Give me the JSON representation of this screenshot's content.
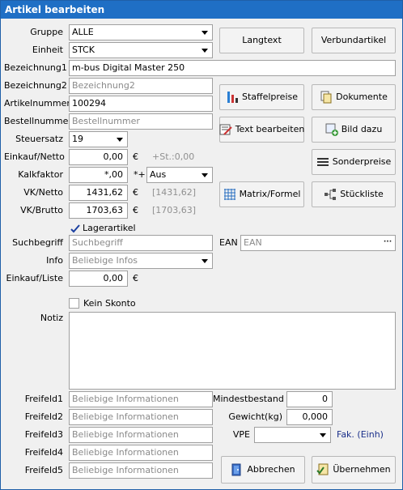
{
  "window": {
    "title": "Artikel bearbeiten"
  },
  "form": {
    "gruppe": {
      "label": "Gruppe",
      "value": "ALLE"
    },
    "einheit": {
      "label": "Einheit",
      "value": "STCK"
    },
    "bezeichnung1": {
      "label": "Bezeichnung1",
      "value": "m-bus Digital Master 250"
    },
    "bezeichnung2": {
      "label": "Bezeichnung2",
      "placeholder": "Bezeichnung2"
    },
    "artikelnummer": {
      "label": "Artikelnummer",
      "value": "100294"
    },
    "bestellnummer": {
      "label": "Bestellnummer",
      "placeholder": "Bestellnummer"
    },
    "steuersatz": {
      "label": "Steuersatz",
      "value": "19"
    },
    "einkauf_netto": {
      "label": "Einkauf/Netto",
      "value": "0,00",
      "currency": "€",
      "extra": "+St.:0,00"
    },
    "kalkfaktor": {
      "label": "Kalkfaktor",
      "value": "*,00",
      "operator": "*+",
      "mode": "Aus"
    },
    "vk_netto": {
      "label": "VK/Netto",
      "value": "1431,62",
      "currency": "€",
      "bracket": "[1431,62]"
    },
    "vk_brutto": {
      "label": "VK/Brutto",
      "value": "1703,63",
      "currency": "€",
      "bracket": "[1703,63]"
    },
    "lagerartikel": {
      "label": "Lagerartikel",
      "checked": true
    },
    "suchbegriff": {
      "label": "Suchbegriff",
      "placeholder": "Suchbegriff"
    },
    "ean": {
      "label": "EAN",
      "placeholder": "EAN",
      "button": "···"
    },
    "info": {
      "label": "Info",
      "placeholder": "Beliebige Infos"
    },
    "einkauf_liste": {
      "label": "Einkauf/Liste",
      "value": "0,00",
      "currency": "€"
    },
    "kein_skonto": {
      "label": "Kein Skonto",
      "checked": false
    },
    "notiz": {
      "label": "Notiz",
      "value": ""
    },
    "freifelder": [
      {
        "label": "Freifeld1",
        "placeholder": "Beliebige Informationen"
      },
      {
        "label": "Freifeld2",
        "placeholder": "Beliebige Informationen"
      },
      {
        "label": "Freifeld3",
        "placeholder": "Beliebige Informationen"
      },
      {
        "label": "Freifeld4",
        "placeholder": "Beliebige Informationen"
      },
      {
        "label": "Freifeld5",
        "placeholder": "Beliebige Informationen"
      }
    ],
    "mindestbestand": {
      "label": "Mindestbestand",
      "value": "0"
    },
    "gewicht": {
      "label": "Gewicht(kg)",
      "value": "0,000"
    },
    "vpe": {
      "label": "VPE",
      "value": "",
      "unit_text": "Fak. (Einh)"
    }
  },
  "buttons": {
    "langtext": "Langtext",
    "verbundartikel": "Verbundartikel",
    "staffelpreise": "Staffelpreise",
    "dokumente": "Dokumente",
    "text_bearbeiten": "Text bearbeiten",
    "bild_dazu": "Bild dazu",
    "sonderpreise": "Sonderpreise",
    "matrix_formel": "Matrix/Formel",
    "stueckliste": "Stückliste",
    "abbrechen": "Abbrechen",
    "uebernehmen": "Übernehmen"
  },
  "colors": {
    "titlebar": "#1f6fc5",
    "window_bg": "#f0f0f0",
    "placeholder": "#8a8a8a",
    "link_text": "#1a2f8a"
  }
}
